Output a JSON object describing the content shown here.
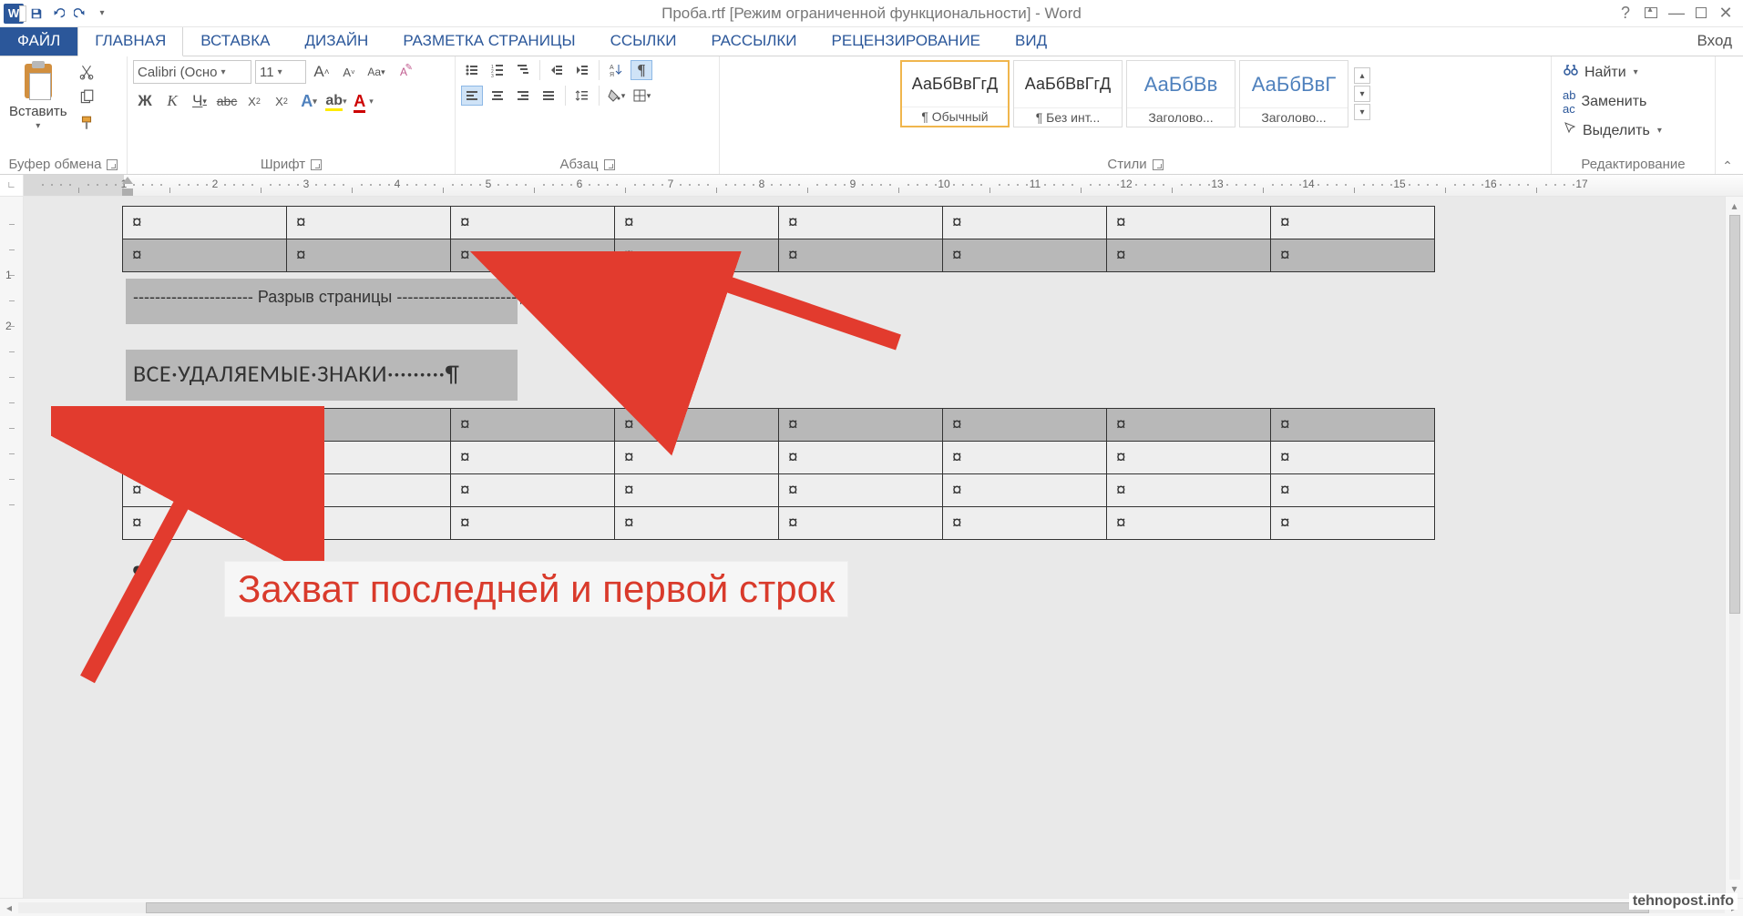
{
  "title": "Проба.rtf [Режим ограниченной функциональности] - Word",
  "login": "Вход",
  "tabs": {
    "file": "ФАЙЛ",
    "home": "ГЛАВНАЯ",
    "insert": "ВСТАВКА",
    "design": "ДИЗАЙН",
    "layout": "РАЗМЕТКА СТРАНИЦЫ",
    "references": "ССЫЛКИ",
    "mailings": "РАССЫЛКИ",
    "review": "РЕЦЕНЗИРОВАНИЕ",
    "view": "ВИД"
  },
  "ribbon": {
    "clipboard": {
      "paste": "Вставить",
      "group": "Буфер обмена"
    },
    "font": {
      "family": "Calibri (Осно",
      "size": "11",
      "group": "Шрифт"
    },
    "para": {
      "group": "Абзац"
    },
    "styles": {
      "group": "Стили",
      "items": [
        {
          "sample": "АаБбВвГгД",
          "name": "¶ Обычный",
          "color": "#333"
        },
        {
          "sample": "АаБбВвГгД",
          "name": "¶ Без инт...",
          "color": "#333"
        },
        {
          "sample": "АаБбВв",
          "name": "Заголово...",
          "color": "#4f81bd"
        },
        {
          "sample": "АаБбВвГ",
          "name": "Заголово...",
          "color": "#4f81bd"
        }
      ]
    },
    "editing": {
      "find": "Найти",
      "replace": "Заменить",
      "select": "Выделить",
      "group": "Редактирование"
    }
  },
  "ruler": {
    "min": 1,
    "max": 17
  },
  "document": {
    "cell": "¤",
    "page_break": "---------------------- Разрыв страницы ----------------------¶",
    "heading": "ВСЕ·УДАЛЯЕМЫЕ·ЗНАКИ·········¶",
    "para_mark": "¶",
    "table1_cols": 8,
    "table2_cols": 8
  },
  "annotation": "Захват последней и первой строк",
  "watermark": "tehnopost.info"
}
